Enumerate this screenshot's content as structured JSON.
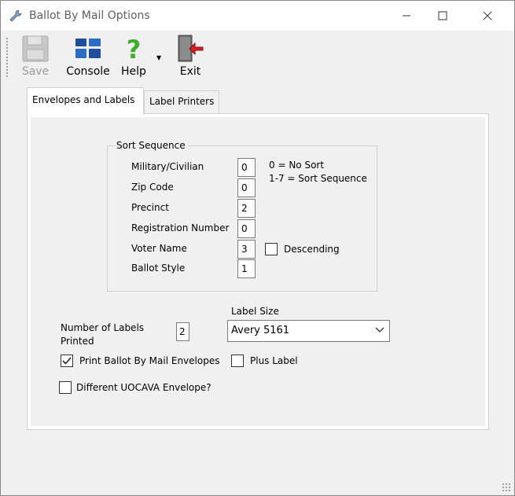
{
  "window": {
    "title": "Ballot By Mail Options"
  },
  "toolbar": {
    "save_label": "Save",
    "console_label": "Console",
    "help_label": "Help",
    "exit_label": "Exit"
  },
  "tabs": [
    {
      "label": "Envelopes and Labels",
      "active": true
    },
    {
      "label": "Label Printers",
      "active": false
    }
  ],
  "sort_sequence": {
    "title": "Sort Sequence",
    "legend_line1": "0 = No Sort",
    "legend_line2": "1-7 = Sort Sequence",
    "fields": [
      {
        "label": "Military/Civilian",
        "value": "0"
      },
      {
        "label": "Zip Code",
        "value": "0"
      },
      {
        "label": "Precinct",
        "value": "2"
      },
      {
        "label": "Registration Number",
        "value": "0"
      },
      {
        "label": "Voter Name",
        "value": "3"
      },
      {
        "label": "Ballot Style",
        "value": "1"
      }
    ],
    "descending_label": "Descending",
    "descending_checked": false
  },
  "labels": {
    "count_label": "Number of Labels Printed",
    "count_value": "2",
    "size_label": "Label Size",
    "size_value": "Avery 5161"
  },
  "options": {
    "print_envelopes_label": "Print Ballot By Mail Envelopes",
    "print_envelopes_checked": true,
    "plus_label_label": "Plus Label",
    "plus_label_checked": false,
    "uocava_label": "Different UOCAVA Envelope?",
    "uocava_checked": false
  },
  "icons": {
    "title": "wrench-icon",
    "save": "floppy-disk-icon",
    "console": "console-grid-icon",
    "help": "question-mark-icon",
    "exit": "exit-door-icon"
  }
}
